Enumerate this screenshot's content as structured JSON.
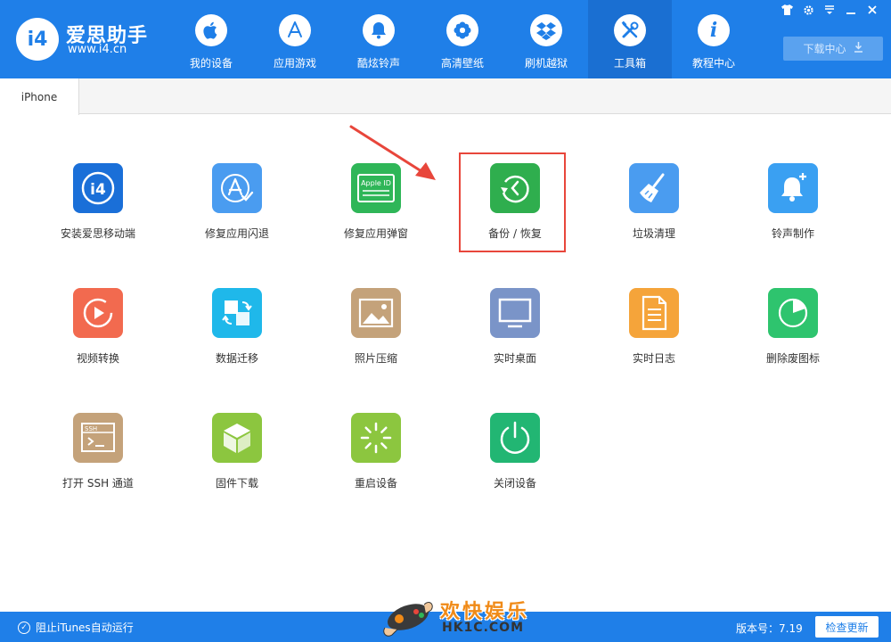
{
  "app": {
    "logo_mark": "i4",
    "name": "爱思助手",
    "url": "www.i4.cn"
  },
  "nav": [
    {
      "label": "我的设备",
      "icon": "apple-icon"
    },
    {
      "label": "应用游戏",
      "icon": "app-store-icon"
    },
    {
      "label": "酷炫铃声",
      "icon": "bell-icon"
    },
    {
      "label": "高清壁纸",
      "icon": "flower-icon"
    },
    {
      "label": "刷机越狱",
      "icon": "dropbox-icon"
    },
    {
      "label": "工具箱",
      "icon": "tools-icon",
      "active": true
    },
    {
      "label": "教程中心",
      "icon": "info-icon"
    }
  ],
  "window_controls": [
    "shirt-icon",
    "gear-icon",
    "menu-icon",
    "minimize-icon",
    "close-icon"
  ],
  "download_center": {
    "label": "下载中心",
    "icon": "download-icon"
  },
  "tabs": [
    {
      "label": "iPhone",
      "active": true
    }
  ],
  "tools": [
    {
      "label": "安装爱思移动端",
      "icon": "i4-app-icon",
      "color": "#1a6fd8"
    },
    {
      "label": "修复应用闪退",
      "icon": "app-store-check-icon",
      "color": "#4a9cf0"
    },
    {
      "label": "修复应用弹窗",
      "icon": "apple-id-icon",
      "color": "#2fb658",
      "icon_text": "Apple ID"
    },
    {
      "label": "备份 / 恢复",
      "icon": "backup-restore-icon",
      "color": "#2fae4e",
      "highlighted": true
    },
    {
      "label": "垃圾清理",
      "icon": "broom-icon",
      "color": "#4a9cf0"
    },
    {
      "label": "铃声制作",
      "icon": "bell-plus-icon",
      "color": "#3aa0f2"
    },
    {
      "label": "视频转换",
      "icon": "video-play-icon",
      "color": "#f26a4f"
    },
    {
      "label": "数据迁移",
      "icon": "data-transfer-icon",
      "color": "#1fb8ea"
    },
    {
      "label": "照片压缩",
      "icon": "photo-icon",
      "color": "#c4a27a"
    },
    {
      "label": "实时桌面",
      "icon": "monitor-icon",
      "color": "#7a94c8"
    },
    {
      "label": "实时日志",
      "icon": "document-icon",
      "color": "#f5a43a"
    },
    {
      "label": "删除废图标",
      "icon": "pie-chart-icon",
      "color": "#2ec46e"
    },
    {
      "label": "打开 SSH 通道",
      "icon": "terminal-icon",
      "color": "#c4a27a",
      "icon_text": "SSH"
    },
    {
      "label": "固件下载",
      "icon": "cube-icon",
      "color": "#8cc63f"
    },
    {
      "label": "重启设备",
      "icon": "loading-spinner-icon",
      "color": "#8cc63f"
    },
    {
      "label": "关闭设备",
      "icon": "power-icon",
      "color": "#22b673"
    }
  ],
  "statusbar": {
    "itunes_block": "阻止iTunes自动运行",
    "version": "版本号：7.19",
    "update_button": "检查更新"
  },
  "watermark": {
    "cn": "欢快娱乐",
    "en": "HK1C.COM"
  },
  "colors": {
    "brand_blue": "#1f7fe8",
    "nav_active": "#1a6fd2",
    "highlight_red": "#e8463b"
  }
}
